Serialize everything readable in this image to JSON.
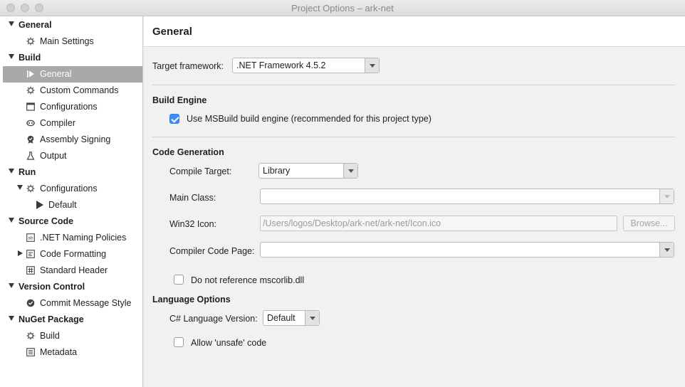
{
  "window": {
    "title": "Project Options – ark-net"
  },
  "sidebar": {
    "items": [
      {
        "label": "General",
        "level": 0,
        "icon": "",
        "expanded": true,
        "bold": true
      },
      {
        "label": "Main Settings",
        "level": 1,
        "icon": "gear-icon"
      },
      {
        "label": "Build",
        "level": 0,
        "icon": "",
        "expanded": true,
        "bold": true
      },
      {
        "label": "General",
        "level": 1,
        "icon": "build-run-icon",
        "selected": true
      },
      {
        "label": "Custom Commands",
        "level": 1,
        "icon": "gear-icon"
      },
      {
        "label": "Configurations",
        "level": 1,
        "icon": "window-icon"
      },
      {
        "label": "Compiler",
        "level": 1,
        "icon": "compiler-icon"
      },
      {
        "label": "Assembly Signing",
        "level": 1,
        "icon": "badge-icon"
      },
      {
        "label": "Output",
        "level": 1,
        "icon": "flask-icon"
      },
      {
        "label": "Run",
        "level": 0,
        "icon": "",
        "expanded": true,
        "bold": true
      },
      {
        "label": "Configurations",
        "level": 1,
        "icon": "gear-icon",
        "expanded": true
      },
      {
        "label": "Default",
        "level": 2,
        "icon": "play-icon"
      },
      {
        "label": "Source Code",
        "level": 0,
        "icon": "",
        "expanded": true,
        "bold": true
      },
      {
        "label": ".NET Naming Policies",
        "level": 1,
        "icon": "naming-icon"
      },
      {
        "label": "Code Formatting",
        "level": 1,
        "icon": "code-format-icon",
        "collapsed": true
      },
      {
        "label": "Standard Header",
        "level": 1,
        "icon": "hash-icon"
      },
      {
        "label": "Version Control",
        "level": 0,
        "icon": "",
        "expanded": true,
        "bold": true
      },
      {
        "label": "Commit Message Style",
        "level": 1,
        "icon": "commit-icon"
      },
      {
        "label": "NuGet Package",
        "level": 0,
        "icon": "",
        "expanded": true,
        "bold": true
      },
      {
        "label": "Build",
        "level": 1,
        "icon": "gear-icon"
      },
      {
        "label": "Metadata",
        "level": 1,
        "icon": "list-icon"
      }
    ]
  },
  "main": {
    "header": "General",
    "target_framework": {
      "label": "Target framework:",
      "value": ".NET Framework 4.5.2"
    },
    "build_engine": {
      "title": "Build Engine",
      "use_msbuild": {
        "label": "Use MSBuild build engine (recommended for this project type)",
        "checked": true
      }
    },
    "code_generation": {
      "title": "Code Generation",
      "compile_target": {
        "label": "Compile Target:",
        "value": "Library"
      },
      "main_class": {
        "label": "Main Class:",
        "value": ""
      },
      "win32_icon": {
        "label": "Win32 Icon:",
        "value": "/Users/logos/Desktop/ark-net/ark-net/Icon.ico",
        "browse": "Browse..."
      },
      "code_page": {
        "label": "Compiler Code Page:",
        "value": ""
      },
      "no_mscorlib": {
        "label": "Do not reference mscorlib.dll",
        "checked": false
      }
    },
    "language_options": {
      "title": "Language Options",
      "lang_version": {
        "label": "C# Language Version:",
        "value": "Default"
      },
      "allow_unsafe": {
        "label": "Allow 'unsafe' code",
        "checked": false
      }
    }
  },
  "colors": {
    "selection": "#a9a9a9",
    "checkbox_accent": "#3d8ff5"
  }
}
